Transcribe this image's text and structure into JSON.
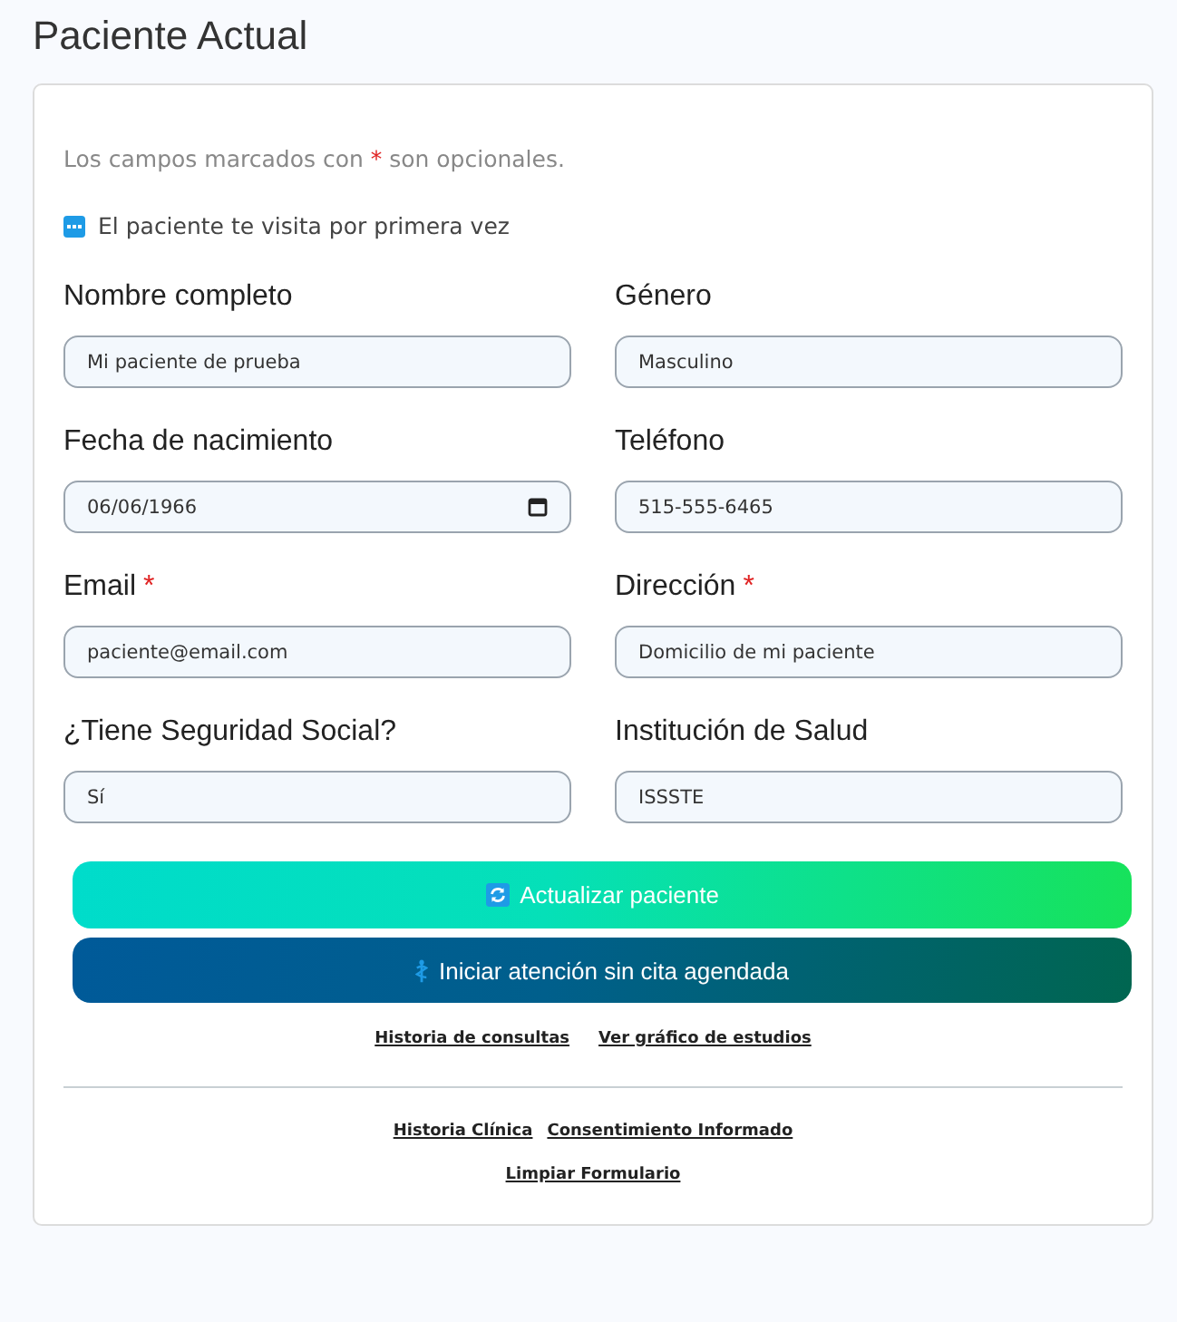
{
  "title": "Paciente Actual",
  "note": {
    "before": "Los campos marcados con",
    "mark": "*",
    "after": "son opcionales."
  },
  "first_visit": {
    "label": "El paciente te visita por primera vez"
  },
  "fields": [
    {
      "label": "Nombre completo",
      "kind": "text",
      "value": "Mi paciente de prueba"
    },
    {
      "label": "Género",
      "kind": "text",
      "value": "Masculino"
    },
    {
      "label": "Fecha de nacimiento",
      "kind": "date",
      "value": "06/06/1966"
    },
    {
      "label": "Teléfono",
      "kind": "text",
      "value": "515-555-6465"
    },
    {
      "label": "Email",
      "marker": "*",
      "kind": "text",
      "value": "paciente@email.com"
    },
    {
      "label": "Dirección",
      "marker": "*",
      "kind": "text",
      "value": "Domicilio de mi paciente"
    },
    {
      "label": "¿Tiene Seguridad Social?",
      "kind": "text",
      "value": "Sí"
    },
    {
      "label": "Institución de Salud",
      "kind": "text",
      "value": "ISSSTE"
    }
  ],
  "buttons": [
    {
      "kind": "update",
      "label": "Actualizar paciente"
    },
    {
      "kind": "attend",
      "label": "Iniciar atención sin cita agendada"
    }
  ],
  "links": [
    [
      "Historia de consultas",
      "Ver gráfico de estudios"
    ]
  ],
  "footer_links": [
    [
      "Historia Clínica",
      "Consentimiento Informado"
    ],
    [
      "Limpiar Formulario"
    ]
  ]
}
